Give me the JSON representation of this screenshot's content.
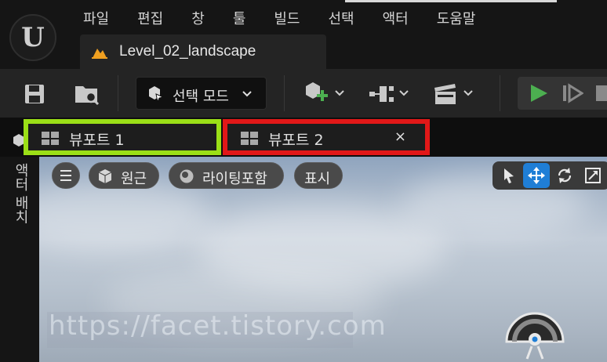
{
  "menu": [
    "파일",
    "편집",
    "창",
    "툴",
    "빌드",
    "선택",
    "액터",
    "도움말"
  ],
  "level_tab": {
    "name": "Level_02_landscape"
  },
  "toolbar": {
    "mode_label": "선택 모드"
  },
  "viewport_tabs": [
    {
      "label": "뷰포트 1",
      "highlight": "#9bdf17"
    },
    {
      "label": "뷰포트 2",
      "highlight": "#e11818",
      "close": "×"
    }
  ],
  "side_panel": {
    "label": "액터 배치"
  },
  "viewport": {
    "buttons": {
      "perspective": "원근",
      "lighting": "라이팅포함",
      "show": "표시"
    },
    "watermark": "https://facet.tistory.com"
  },
  "colors": {
    "accent": "#1f7ed6",
    "play": "#4caf50"
  }
}
